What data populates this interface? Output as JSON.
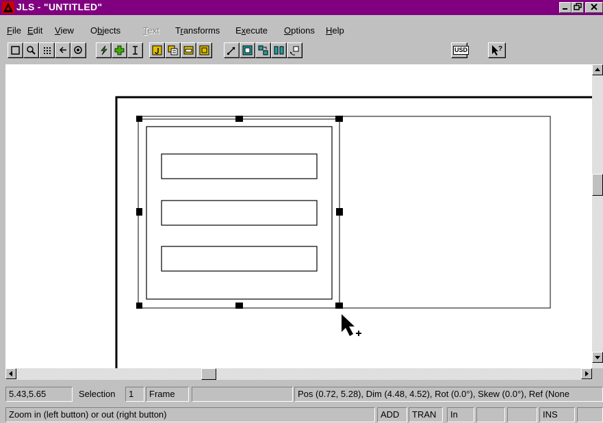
{
  "window": {
    "title": "JLS - \"UNTITLED\""
  },
  "menu": [
    {
      "label": "File",
      "disabled": false
    },
    {
      "label": "Edit",
      "disabled": false
    },
    {
      "label": "View",
      "disabled": false
    },
    {
      "label": "Objects",
      "disabled": false
    },
    {
      "label": "Text",
      "disabled": true
    },
    {
      "label": "Transforms",
      "disabled": false
    },
    {
      "label": "Execute",
      "disabled": false
    },
    {
      "label": "Options",
      "disabled": false
    },
    {
      "label": "Help",
      "disabled": false
    }
  ],
  "toolbar": {
    "usd_label": "USD",
    "tools": [
      "select-rect-icon",
      "zoom-icon",
      "grid-icon",
      "back-arrow-icon",
      "eye-icon",
      "wire-tool-icon",
      "add-icon",
      "text-cursor-icon",
      "gate-j-icon",
      "copy-icon",
      "block-icon",
      "circuit-icon",
      "resize-icon",
      "frame-icon",
      "flip-icon",
      "align-icon",
      "rotate-icon",
      "usd-icon",
      "help-pointer-icon"
    ]
  },
  "status": {
    "coords": "5.43,5.65",
    "mode_label": "Selection",
    "count": "1",
    "object_type": "Frame",
    "details": "Pos (0.72, 5.28), Dim (4.48, 4.52), Rot (0.0°), Skew (0.0°), Ref (None",
    "hint": "Zoom in (left button) or out (right button)",
    "add": "ADD",
    "tran": "TRAN",
    "units": "In",
    "ins": "INS"
  },
  "colors": {
    "title_bar": "#800080",
    "chrome": "#c0c0c0",
    "canvas": "#ffffff"
  }
}
